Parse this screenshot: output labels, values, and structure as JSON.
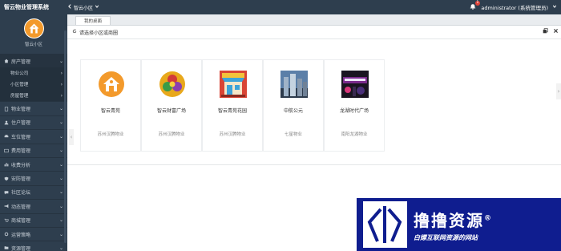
{
  "app": {
    "title": "智云物业管理系统",
    "community_selector": "智云小区",
    "notifications_count": "1",
    "user": "administrator (系统管理员)"
  },
  "sidebar": {
    "avatar_label": "智云小区",
    "menu": [
      {
        "label": "房产管理",
        "open": true,
        "children": [
          "物业公司",
          "小区管理",
          "房屋管理"
        ]
      },
      {
        "label": "物业管理"
      },
      {
        "label": "住户管理"
      },
      {
        "label": "车位管理"
      },
      {
        "label": "费用管理"
      },
      {
        "label": "收费分析"
      },
      {
        "label": "安防管理"
      },
      {
        "label": "社区论坛"
      },
      {
        "label": "动态管理"
      },
      {
        "label": "商城管理"
      },
      {
        "label": "运营策略"
      },
      {
        "label": "资源管理"
      }
    ]
  },
  "tabs": [
    {
      "label": "我的桌面"
    }
  ],
  "panel": {
    "title": "请选择小区或商圈"
  },
  "communities": [
    {
      "name": "智云青苑",
      "org": "苏州汉腾物业",
      "icon": "house-logo-icon"
    },
    {
      "name": "智云财富广场",
      "org": "苏州汉腾物业",
      "icon": "emblem-logo-icon"
    },
    {
      "name": "智云青苑花园",
      "org": "苏州汉腾物业",
      "icon": "storefront-icon"
    },
    {
      "name": "中航公元",
      "org": "七星物业",
      "icon": "skyscraper-photo-icon"
    },
    {
      "name": "龙湖时代广场",
      "org": "南阳龙湖物业",
      "icon": "neon-sign-photo-icon"
    }
  ],
  "watermark": {
    "title": "撸撸资源",
    "mark": "®",
    "subtitle": "白嫖互联网资源的网站"
  },
  "colors": {
    "sidebar_bg": "#2e3e4e",
    "watermark_bg": "#0f1d8f",
    "accent_orange": "#f39a2c"
  }
}
